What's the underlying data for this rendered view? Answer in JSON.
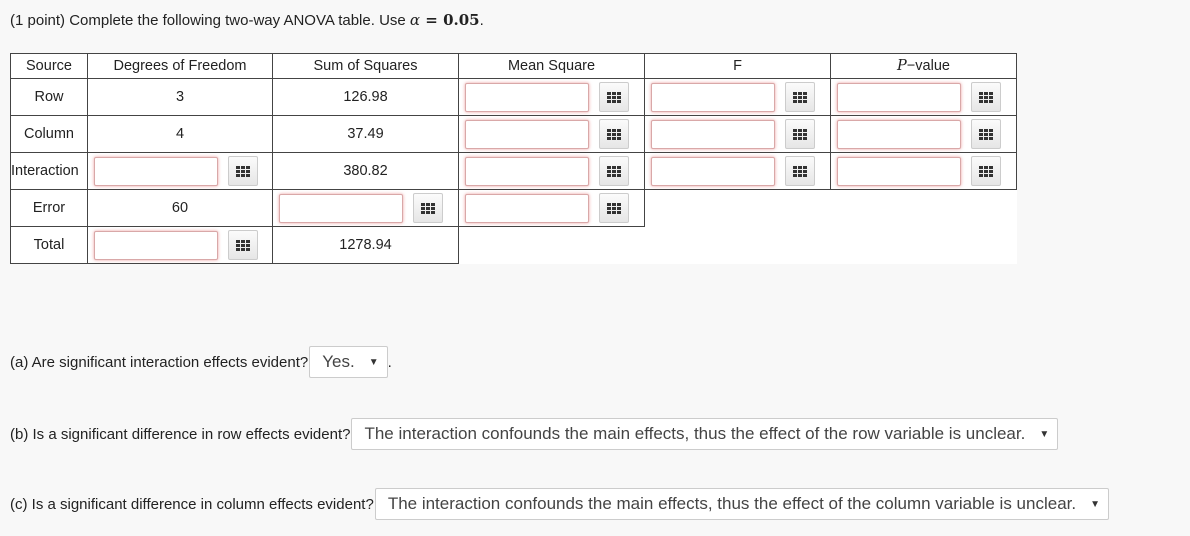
{
  "problem": {
    "prefix": "(1 point) Complete the following two-way ANOVA table. Use ",
    "alpha_symbol": "α",
    "equals": " = ",
    "alpha_value": "0.05",
    "suffix": "."
  },
  "table": {
    "headers": {
      "source": "Source",
      "df": "Degrees of Freedom",
      "ss": "Sum of Squares",
      "ms": "Mean Square",
      "f": "F",
      "p_letter": "P",
      "p_rest": "−value"
    },
    "rows": {
      "row": {
        "source": "Row",
        "df": "3",
        "ss": "126.98"
      },
      "column": {
        "source": "Column",
        "df": "4",
        "ss": "37.49"
      },
      "interaction": {
        "source": "Interaction",
        "ss": "380.82"
      },
      "error": {
        "source": "Error",
        "df": "60"
      },
      "total": {
        "source": "Total",
        "ss": "1278.94"
      }
    }
  },
  "questions": {
    "a": {
      "text": "(a) Are significant interaction effects evident?",
      "selected": "Yes."
    },
    "b": {
      "text": "(b) Is a significant difference in row effects evident?",
      "selected": "The interaction confounds the main effects, thus the effect of the row variable is unclear."
    },
    "c": {
      "text": "(c) Is a significant difference in column effects evident?",
      "selected": "The interaction confounds the main effects, thus the effect of the column variable is unclear."
    }
  },
  "icons": {
    "answer_helper": "grid-icon",
    "dropdown": "caret-down-icon"
  },
  "colors": {
    "input_glow": "#dc5050",
    "border": "#444444"
  }
}
